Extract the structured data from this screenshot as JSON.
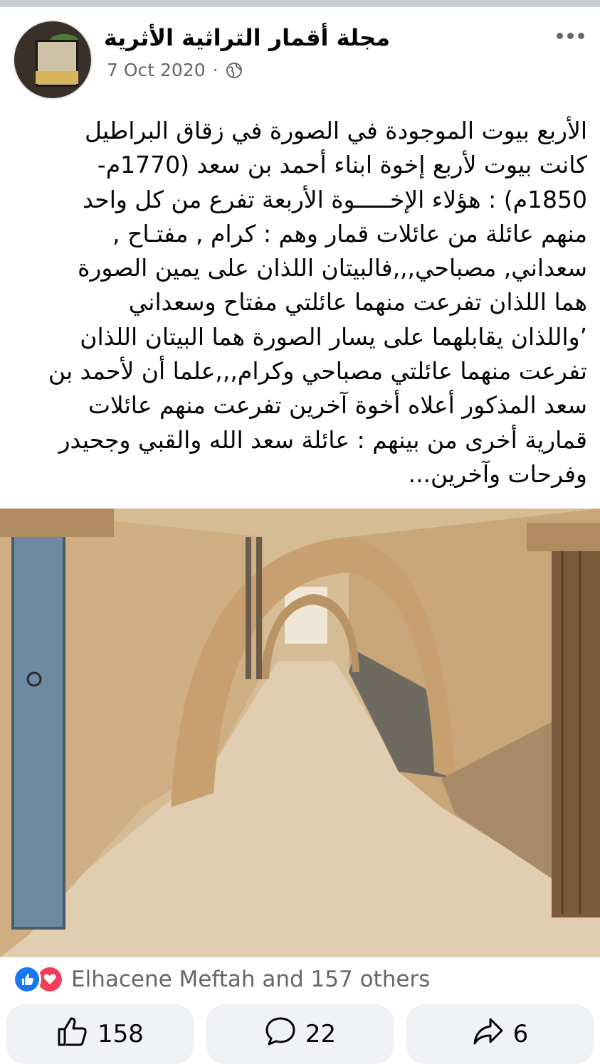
{
  "post": {
    "page_name": "مجلة أقمار التراثية الأثرية",
    "date": "7 Oct 2020",
    "separator": "·",
    "audience_icon": "globe-icon",
    "more_icon": "more-options-icon",
    "text_lines": [
      "الأربع بيوت الموجودة في الصورة في زقاق البراطيل",
      "كانت بيوت  لأربع إخوة  ابناء أحمد بن سعد (1770م-",
      "1850م) : هؤلاء الإخـــــوة الأربعة  تفرع من كل واحد",
      "منهم عائلة  من عائلات قمار وهم :  كرام , مفتـاح ,",
      "سعداني, مصباحي,,,فالبيتان اللذان على يمين الصورة",
      "هما  اللذان تفرعت منهما عائلتي مفتاح وسعداني",
      "’واللذان يقابلهما على يسار الصورة هما البيتان اللذان",
      "تفرعت منهما  عائلتي مصباحي وكرام,,,علما أن لأحمد بن",
      "سعد المذكور أعلاه أخوة آخرين تفرعت منهم عائلات",
      "قمارية أخرى من بينهم : عائلة سعد الله والقبي وجحيدر",
      "وفرحات وآخرين..."
    ]
  },
  "reactions": {
    "icons": [
      "like-icon",
      "love-icon"
    ],
    "summary": "Elhacene Meftah and 157 others"
  },
  "actions": {
    "like_count": "158",
    "comment_count": "22",
    "share_count": "6"
  },
  "colors": {
    "like_blue": "#1877f2",
    "love_red": "#f33e58",
    "meta_gray": "#65676b",
    "button_bg": "#f0f2f5"
  }
}
